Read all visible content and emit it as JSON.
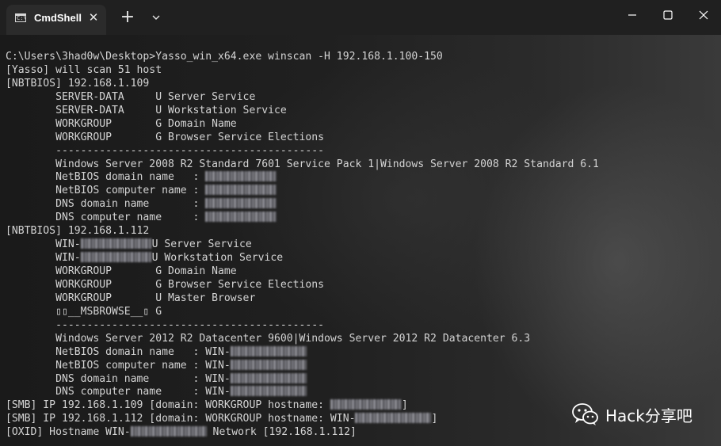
{
  "window": {
    "tab_title": "CmdShell",
    "tab_icon": "cmd-icon",
    "controls": {
      "minimize_icon": "minimize-icon",
      "maximize_icon": "maximize-icon",
      "close_icon": "close-icon"
    },
    "new_tab_icon": "plus-icon",
    "dropdown_icon": "chevron-down-icon",
    "close_tab_glyph": "✕",
    "new_tab_glyph": "+"
  },
  "terminal": {
    "lines": [
      [
        {
          "t": "C:\\Users\\3had0w\\Desktop>Yasso_win_x64.exe winscan -H 192.168.1.100-150"
        }
      ],
      [
        {
          "t": "[Yasso] will scan 51 host"
        }
      ],
      [
        {
          "t": "[NBTBIOS] 192.168.1.109"
        }
      ],
      [
        {
          "t": "        SERVER-DATA     U Server Service"
        }
      ],
      [
        {
          "t": "        SERVER-DATA     U Workstation Service"
        }
      ],
      [
        {
          "t": "        WORKGROUP       G Domain Name"
        }
      ],
      [
        {
          "t": "        WORKGROUP       G Browser Service Elections"
        }
      ],
      [
        {
          "t": "        -------------------------------------------"
        }
      ],
      [
        {
          "t": "        Windows Server 2008 R2 Standard 7601 Service Pack 1|Windows Server 2008 R2 Standard 6.1"
        }
      ],
      [
        {
          "t": "        NetBIOS domain name   : "
        },
        {
          "r": 90
        }
      ],
      [
        {
          "t": "        NetBIOS computer name : "
        },
        {
          "r": 90
        }
      ],
      [
        {
          "t": "        DNS domain name       : "
        },
        {
          "r": 90
        }
      ],
      [
        {
          "t": "        DNS computer name     : "
        },
        {
          "r": 90
        }
      ],
      [
        {
          "t": "[NBTBIOS] 192.168.1.112"
        }
      ],
      [
        {
          "t": "        WIN-"
        },
        {
          "r": 90
        },
        {
          "t": "U Server Service"
        }
      ],
      [
        {
          "t": "        WIN-"
        },
        {
          "r": 90
        },
        {
          "t": "U Workstation Service"
        }
      ],
      [
        {
          "t": "        WORKGROUP       G Domain Name"
        }
      ],
      [
        {
          "t": "        WORKGROUP       G Browser Service Elections"
        }
      ],
      [
        {
          "t": "        WORKGROUP       U Master Browser"
        }
      ],
      [
        {
          "t": "        ▯▯__MSBROWSE__▯ G"
        }
      ],
      [
        {
          "t": "        -------------------------------------------"
        }
      ],
      [
        {
          "t": "        Windows Server 2012 R2 Datacenter 9600|Windows Server 2012 R2 Datacenter 6.3"
        }
      ],
      [
        {
          "t": "        NetBIOS domain name   : WIN-"
        },
        {
          "r": 96
        }
      ],
      [
        {
          "t": "        NetBIOS computer name : WIN-"
        },
        {
          "r": 96
        }
      ],
      [
        {
          "t": "        DNS domain name       : WIN-"
        },
        {
          "r": 96
        }
      ],
      [
        {
          "t": "        DNS computer name     : WIN-"
        },
        {
          "r": 96
        }
      ],
      [
        {
          "t": "[SMB] IP 192.168.1.109 [domain: WORKGROUP hostname: "
        },
        {
          "r": 90
        },
        {
          "t": "]"
        }
      ],
      [
        {
          "t": "[SMB] IP 192.168.1.112 [domain: WORKGROUP hostname: WIN-"
        },
        {
          "r": 96
        },
        {
          "t": "]"
        }
      ],
      [
        {
          "t": "[OXID] Hostname WIN-"
        },
        {
          "r": 96
        },
        {
          "t": " Network [192.168.1.112]"
        }
      ]
    ]
  },
  "watermark": {
    "text": "Hack分享吧",
    "logo_icon": "wechat-icon"
  },
  "colors": {
    "text": "#d4d4d4",
    "titlebar": "#202020",
    "tab": "#2b2b2b"
  }
}
